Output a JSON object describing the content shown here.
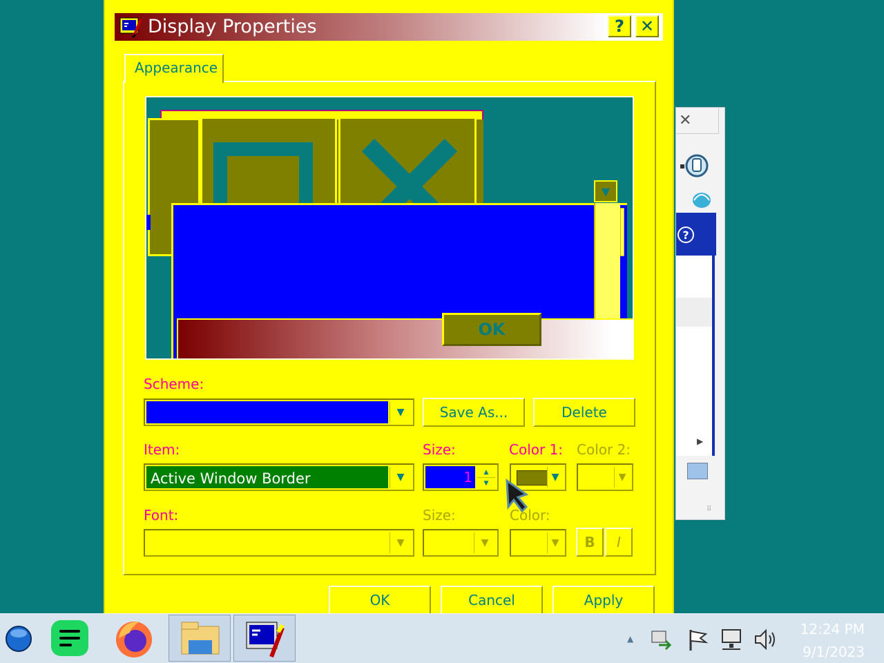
{
  "dialog": {
    "title": "Display Properties",
    "help_glyph": "?",
    "close_glyph": "✕",
    "tab_label": "Appearance"
  },
  "preview": {
    "ok_label": "OK"
  },
  "scheme": {
    "label": "Scheme:",
    "value": "",
    "save_as_label": "Save As...",
    "delete_label": "Delete"
  },
  "item": {
    "label": "Item:",
    "value": "Active Window Border",
    "size_label": "Size:",
    "size_value": "1",
    "color1_label": "Color 1:",
    "color2_label": "Color 2:",
    "color1_swatch": "#808000"
  },
  "font": {
    "label": "Font:",
    "size_label": "Size:",
    "color_label": "Color:",
    "bold_label": "B",
    "italic_label": "I"
  },
  "footer": {
    "ok_label": "OK",
    "cancel_label": "Cancel",
    "apply_label": "Apply"
  },
  "taskbar": {
    "time": "12:24 PM",
    "date": "9/1/2023",
    "apps": [
      "start-orb-icon",
      "notes-app-icon",
      "firefox-icon",
      "file-explorer-icon",
      "display-properties-icon"
    ],
    "tray": [
      "tray-overflow-icon",
      "network-transfer-icon",
      "flag-icon",
      "network-icon",
      "volume-icon"
    ]
  },
  "colors": {
    "dialog_bg": "#ffff00",
    "desktop": "#087c7c",
    "accent_text": "#008080",
    "label_pink": "#ff00a0",
    "selected_green": "#008000",
    "scheme_blue": "#0000ff"
  }
}
